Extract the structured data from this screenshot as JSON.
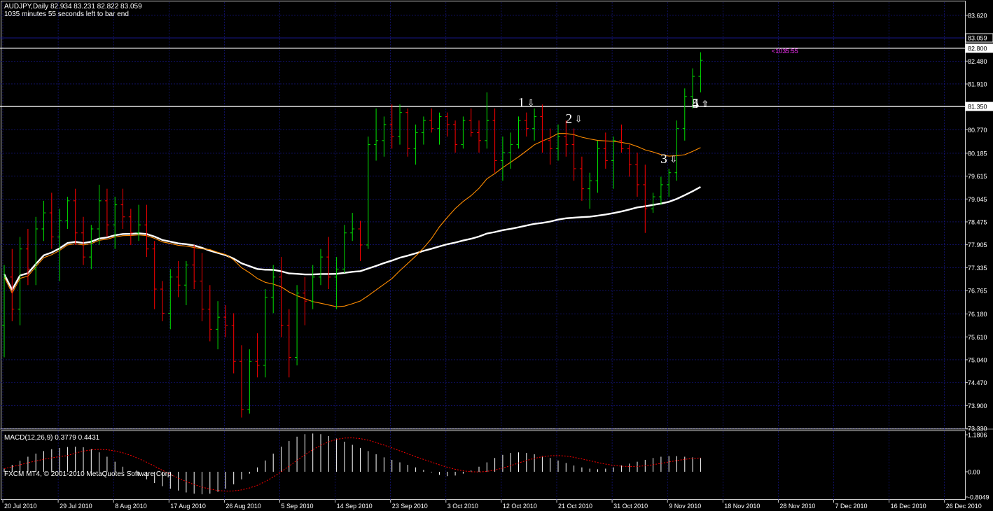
{
  "header": {
    "symbol_info": "AUDJPY,Daily  82.934 83.231 82.822 83.059",
    "countdown": "1035 minutes 55 seconds left to bar end"
  },
  "macd_header": "MACD(12,26,9) 0.3779 0.4431",
  "copyright": "FXCM MT4, © 2001-2010 MetaQuotes Software Corp.",
  "bar_countdown_label": "<1035:55",
  "colors": {
    "background": "#000000",
    "bull": "#00e000",
    "bear": "#ff0000",
    "ma_fast": "#ff8c00",
    "ma_slow": "#ffffff",
    "grid": "#1a1a9a",
    "hline": "#ffffff"
  },
  "chart_data": {
    "type": "candlestick",
    "price_axis": {
      "ticks": [
        "83.620",
        "83.059",
        "82.800",
        "82.480",
        "81.910",
        "81.350",
        "80.770",
        "80.185",
        "79.615",
        "79.045",
        "78.475",
        "77.905",
        "77.335",
        "76.765",
        "76.180",
        "75.610",
        "75.040",
        "74.470",
        "73.900",
        "73.330"
      ],
      "range": [
        73.33,
        83.95
      ]
    },
    "time_axis": {
      "labels": [
        "20 Jul 2010",
        "29 Jul 2010",
        "8 Aug 2010",
        "17 Aug 2010",
        "26 Aug 2010",
        "5 Sep 2010",
        "14 Sep 2010",
        "23 Sep 2010",
        "3 Oct 2010",
        "12 Oct 2010",
        "21 Oct 2010",
        "31 Oct 2010",
        "9 Nov 2010",
        "18 Nov 2010",
        "28 Nov 2010",
        "7 Dec 2010",
        "16 Dec 2010",
        "26 Dec 2010"
      ],
      "labels_per_tick_bars": 7
    },
    "horizontal_lines": [
      82.8,
      81.35
    ],
    "current_price": 83.059,
    "annotations": [
      {
        "label": "1",
        "arrow": "⇩",
        "bar": 66
      },
      {
        "label": "2",
        "arrow": "⇩",
        "bar": 72
      },
      {
        "label": "3",
        "arrow": "⇩",
        "bar": 84
      },
      {
        "label": "4",
        "arrow": "⇧",
        "bar": 89
      },
      {
        "label": "5",
        "arrow": "⇧",
        "bar": 95
      }
    ],
    "bars": [
      [
        75.9,
        77.4,
        75.1,
        77.1
      ],
      [
        77.1,
        77.8,
        76.0,
        76.3
      ],
      [
        76.3,
        78.1,
        75.9,
        77.8
      ],
      [
        77.8,
        78.3,
        76.9,
        77.3
      ],
      [
        77.3,
        78.6,
        76.9,
        78.3
      ],
      [
        78.3,
        79.0,
        78.0,
        78.7
      ],
      [
        78.7,
        79.2,
        77.8,
        78.1
      ],
      [
        78.1,
        78.8,
        77.0,
        78.5
      ],
      [
        78.5,
        79.1,
        78.3,
        79.0
      ],
      [
        79.0,
        79.3,
        77.9,
        78.2
      ],
      [
        78.2,
        78.6,
        77.4,
        77.6
      ],
      [
        77.6,
        78.4,
        77.3,
        78.3
      ],
      [
        78.3,
        79.4,
        77.9,
        79.0
      ],
      [
        79.0,
        79.3,
        78.1,
        78.4
      ],
      [
        78.4,
        79.1,
        77.8,
        78.9
      ],
      [
        78.9,
        79.3,
        78.3,
        78.6
      ],
      [
        78.6,
        78.8,
        77.9,
        78.2
      ],
      [
        78.2,
        78.9,
        78.0,
        78.4
      ],
      [
        78.4,
        78.9,
        77.6,
        77.8
      ],
      [
        77.8,
        78.0,
        76.3,
        76.8
      ],
      [
        76.8,
        77.0,
        76.0,
        76.2
      ],
      [
        76.2,
        77.3,
        75.8,
        77.1
      ],
      [
        77.1,
        77.5,
        76.6,
        76.9
      ],
      [
        76.9,
        77.5,
        76.4,
        77.4
      ],
      [
        77.4,
        77.9,
        76.8,
        77.0
      ],
      [
        77.0,
        77.7,
        76.0,
        76.3
      ],
      [
        76.3,
        76.9,
        75.5,
        75.8
      ],
      [
        75.8,
        76.5,
        75.3,
        76.1
      ],
      [
        76.1,
        76.4,
        75.6,
        75.9
      ],
      [
        75.9,
        76.2,
        74.7,
        75.0
      ],
      [
        75.0,
        75.4,
        73.6,
        73.8
      ],
      [
        73.8,
        75.3,
        73.7,
        75.0
      ],
      [
        75.0,
        75.7,
        74.6,
        74.9
      ],
      [
        74.9,
        76.8,
        74.6,
        76.6
      ],
      [
        76.6,
        77.4,
        76.2,
        77.1
      ],
      [
        77.1,
        77.6,
        75.6,
        75.9
      ],
      [
        75.9,
        76.3,
        74.6,
        75.1
      ],
      [
        75.1,
        76.9,
        74.9,
        76.7
      ],
      [
        76.7,
        77.1,
        75.9,
        76.5
      ],
      [
        76.5,
        77.4,
        76.3,
        77.1
      ],
      [
        77.1,
        77.8,
        76.9,
        77.6
      ],
      [
        77.6,
        78.1,
        76.8,
        77.1
      ],
      [
        77.1,
        77.6,
        76.3,
        77.3
      ],
      [
        77.3,
        78.4,
        77.2,
        78.2
      ],
      [
        78.2,
        78.7,
        78.0,
        78.3
      ],
      [
        78.3,
        78.5,
        77.5,
        77.9
      ],
      [
        77.9,
        80.6,
        77.8,
        80.4
      ],
      [
        80.4,
        81.3,
        80.0,
        80.5
      ],
      [
        80.5,
        81.1,
        80.1,
        80.9
      ],
      [
        80.9,
        81.4,
        80.3,
        80.6
      ],
      [
        80.6,
        81.4,
        80.4,
        81.2
      ],
      [
        81.2,
        81.3,
        80.1,
        80.3
      ],
      [
        80.3,
        80.9,
        79.9,
        80.7
      ],
      [
        80.7,
        81.1,
        80.4,
        81.0
      ],
      [
        81.0,
        81.3,
        80.7,
        80.8
      ],
      [
        80.8,
        81.2,
        80.4,
        81.1
      ],
      [
        81.1,
        81.2,
        80.6,
        80.9
      ],
      [
        80.9,
        81.0,
        80.2,
        80.4
      ],
      [
        80.4,
        81.1,
        80.3,
        81.0
      ],
      [
        81.0,
        81.3,
        80.6,
        80.7
      ],
      [
        80.7,
        81.0,
        80.2,
        80.5
      ],
      [
        80.5,
        81.7,
        80.3,
        81.0
      ],
      [
        81.0,
        81.3,
        79.7,
        80.0
      ],
      [
        80.0,
        80.6,
        79.5,
        80.2
      ],
      [
        80.2,
        80.7,
        79.8,
        80.4
      ],
      [
        80.4,
        81.1,
        80.3,
        81.0
      ],
      [
        81.0,
        81.2,
        80.6,
        80.8
      ],
      [
        80.8,
        81.3,
        80.5,
        81.1
      ],
      [
        81.1,
        81.4,
        80.2,
        80.5
      ],
      [
        80.5,
        80.8,
        79.9,
        80.3
      ],
      [
        80.3,
        80.9,
        80.0,
        80.6
      ],
      [
        80.6,
        81.0,
        80.1,
        80.4
      ],
      [
        80.4,
        80.8,
        79.5,
        79.8
      ],
      [
        79.8,
        80.1,
        79.0,
        79.3
      ],
      [
        79.3,
        79.7,
        78.8,
        79.5
      ],
      [
        79.5,
        80.5,
        79.2,
        80.3
      ],
      [
        80.3,
        80.7,
        79.8,
        80.0
      ],
      [
        80.0,
        80.6,
        79.3,
        80.5
      ],
      [
        80.5,
        80.9,
        80.2,
        80.3
      ],
      [
        80.3,
        80.4,
        79.6,
        79.9
      ],
      [
        79.9,
        80.2,
        79.1,
        79.4
      ],
      [
        79.4,
        79.9,
        78.2,
        78.8
      ],
      [
        78.8,
        79.2,
        78.7,
        79.1
      ],
      [
        79.1,
        79.6,
        78.9,
        79.4
      ],
      [
        79.4,
        79.8,
        79.1,
        79.7
      ],
      [
        79.7,
        81.0,
        79.5,
        80.8
      ],
      [
        80.8,
        81.8,
        80.5,
        81.6
      ],
      [
        81.6,
        82.3,
        81.3,
        82.1
      ],
      [
        82.1,
        82.7,
        81.7,
        82.5
      ]
    ],
    "macd": {
      "axis_ticks": [
        "1.1806",
        "0.00",
        "-0.8049"
      ],
      "range": [
        -0.85,
        1.25
      ],
      "hist": [
        0.1,
        0.22,
        0.35,
        0.48,
        0.58,
        0.66,
        0.72,
        0.76,
        0.79,
        0.8,
        0.78,
        0.72,
        0.62,
        0.48,
        0.32,
        0.16,
        0.02,
        -0.12,
        -0.24,
        -0.36,
        -0.46,
        -0.54,
        -0.6,
        -0.66,
        -0.7,
        -0.72,
        -0.7,
        -0.64,
        -0.54,
        -0.4,
        -0.24,
        -0.06,
        0.14,
        0.36,
        0.58,
        0.8,
        0.98,
        1.12,
        1.2,
        1.22,
        1.2,
        1.14,
        1.06,
        0.96,
        0.86,
        0.76,
        0.66,
        0.56,
        0.46,
        0.38,
        0.3,
        0.22,
        0.14,
        0.06,
        -0.02,
        -0.1,
        -0.14,
        -0.12,
        -0.06,
        0.04,
        0.16,
        0.3,
        0.44,
        0.54,
        0.6,
        0.62,
        0.6,
        0.56,
        0.5,
        0.44,
        0.36,
        0.28,
        0.2,
        0.14,
        0.1,
        0.08,
        0.1,
        0.14,
        0.2,
        0.26,
        0.32,
        0.38,
        0.44,
        0.48,
        0.5,
        0.5,
        0.48,
        0.46,
        0.44
      ],
      "signal_range_note": "signal line drawn from hist smoothing"
    }
  }
}
